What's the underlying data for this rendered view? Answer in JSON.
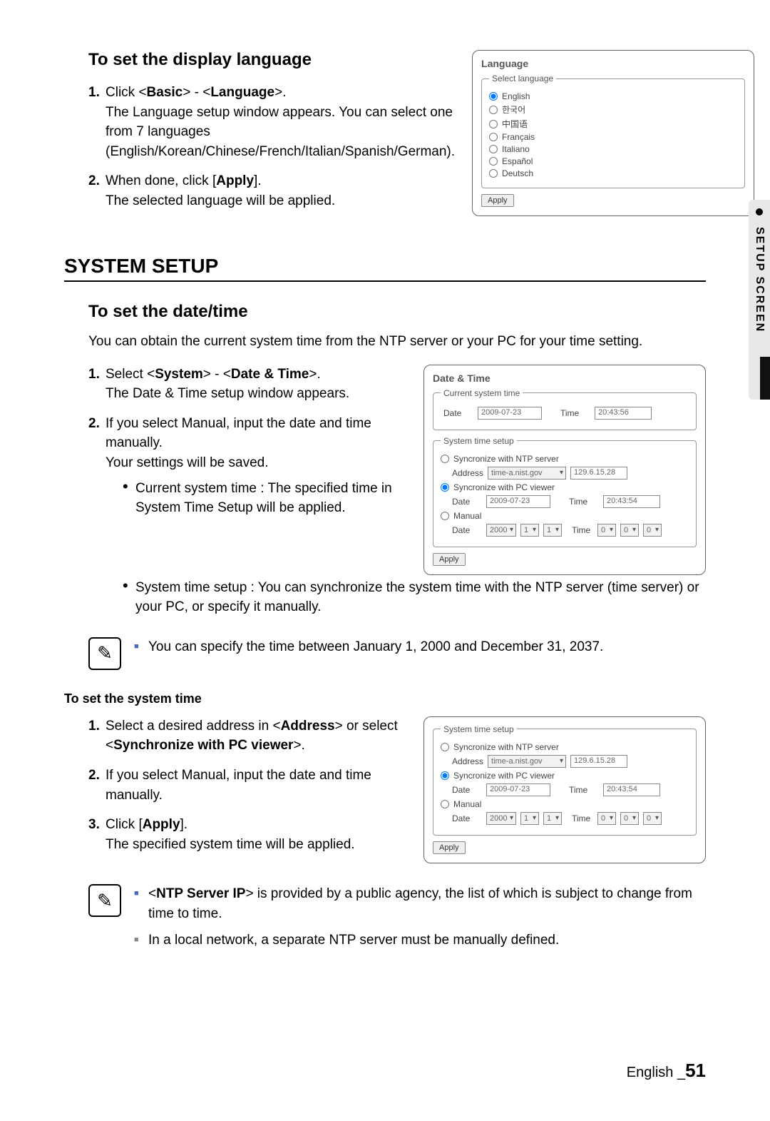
{
  "sidebar": {
    "label": "SETUP SCREEN"
  },
  "s1": {
    "title": "To set the display language",
    "step1_num": "1.",
    "step1_click": "Click <",
    "step1_basic": "Basic",
    "step1_mid": "> - <",
    "step1_lang": "Language",
    "step1_end": ">.",
    "step1_body": "The Language setup window appears. You can select one from 7 languages (English/Korean/Chinese/French/Italian/Spanish/German).",
    "step2_num": "2.",
    "step2_a": "When done, click [",
    "step2_apply": "Apply",
    "step2_b": "].",
    "step2_body": "The selected language will be applied."
  },
  "langPanel": {
    "title": "Language",
    "legend": "Select language",
    "opts": [
      "English",
      "한국어",
      "中国语",
      "Français",
      "Italiano",
      "Español",
      "Deutsch"
    ],
    "apply": "Apply"
  },
  "sys": {
    "heading": "SYSTEM SETUP",
    "sub": "To set the date/time",
    "intro": "You can obtain the current system time from the NTP server or your PC for your time setting.",
    "step1_num": "1.",
    "step1_a": "Select <",
    "step1_system": "System",
    "step1_mid": "> - <",
    "step1_dt": "Date & Time",
    "step1_end": ">.",
    "step1_body": "The Date & Time setup window appears.",
    "step2_num": "2.",
    "step2_body": "If you select Manual, input the date and time manually.",
    "step2_body2": "Your settings will be saved.",
    "bullet1": "Current system time : The specified time in System Time Setup will be applied.",
    "bullet2": "System time setup : You can synchronize the system time with the NTP server (time server) or your PC, or specify it manually."
  },
  "dtPanel": {
    "title": "Date & Time",
    "legend1": "Current system time",
    "dateLabel": "Date",
    "dateVal": "2009-07-23",
    "timeLabel": "Time",
    "timeVal": "20:43:56",
    "legend2": "System time setup",
    "optNtp": "Syncronize with NTP server",
    "addrLabel": "Address",
    "addrVal": "time-a.nist.gov",
    "addrIp": "129.6.15.28",
    "optPc": "Syncronize with PC viewer",
    "pcDate": "2009-07-23",
    "pcTime": "20:43:54",
    "optManual": "Manual",
    "mYear": "2000",
    "mMon": "1",
    "mDay": "1",
    "mH": "0",
    "mM": "0",
    "mS": "0",
    "apply": "Apply"
  },
  "note1": {
    "text": "You can specify the time between January 1, 2000 and December 31, 2037."
  },
  "systime": {
    "title": "To set the system time",
    "step1_num": "1.",
    "step1_a": "Select a desired address in <",
    "step1_addr": "Address",
    "step1_b": "> or select <",
    "step1_pc": "Synchronize with PC viewer",
    "step1_c": ">.",
    "step2_num": "2.",
    "step2_body": "If you select Manual, input the date and time manually.",
    "step3_num": "3.",
    "step3_a": "Click [",
    "step3_apply": "Apply",
    "step3_b": "].",
    "step3_body": "The specified system time will be applied."
  },
  "note2": {
    "li1a": "<",
    "li1b": "NTP Server IP",
    "li1c": "> is provided by a public agency, the list of which is subject to change from time to time.",
    "li2": "In a local network, a separate NTP server must be manually defined."
  },
  "footer": {
    "lang": "English _",
    "page": "51"
  }
}
